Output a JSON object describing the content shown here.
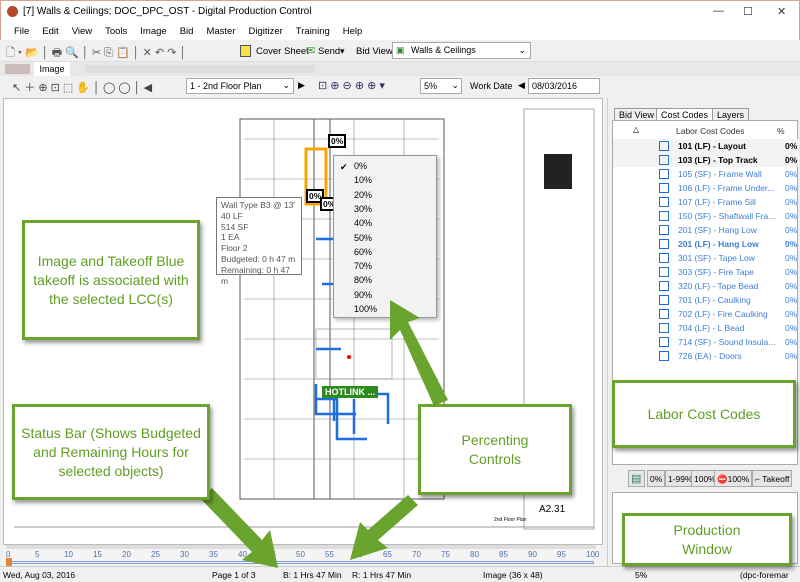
{
  "window": {
    "title": "[7] Walls & Ceilings; DOC_DPC_OST - Digital Production Control",
    "minimize": "—",
    "maximize": "☐",
    "close": "✕"
  },
  "menu": [
    "File",
    "Edit",
    "View",
    "Tools",
    "Image",
    "Bid",
    "Master",
    "Digitizer",
    "Training",
    "Help"
  ],
  "toolbar": {
    "cover_sheet": "Cover Sheet",
    "send": "Send",
    "bid_view_label": "Bid View",
    "bid_view_value": "Walls & Ceilings"
  },
  "tabs": {
    "active": "Image"
  },
  "toolbar2": {
    "page_select": "1 - 2nd Floor Plan",
    "zoom": "5%",
    "work_date_label": "Work Date",
    "work_date": "08/03/2016"
  },
  "popup": {
    "items": [
      "0%",
      "10%",
      "20%",
      "30%",
      "40%",
      "50%",
      "60%",
      "70%",
      "80%",
      "90%",
      "100%"
    ],
    "checked": "0%"
  },
  "tooltip": {
    "lines": [
      "Wall Type B3 @ 13'",
      "40 LF",
      "514 SF",
      "1 EA",
      "Floor 2",
      "Budgeted: 0 h 47 m",
      "Remaining: 0 h 47 m"
    ]
  },
  "badges": [
    "0%",
    "0%",
    "0%"
  ],
  "hotlink": "HOTLINK ...",
  "sheet": {
    "number": "A2.31",
    "title": "2nd Floor Plan"
  },
  "panel": {
    "tabs": [
      "Bid View",
      "Cost Codes",
      "Layers"
    ],
    "active_tab": "Cost Codes",
    "header": "Labor Cost Codes",
    "pct_header": "%",
    "rows": [
      {
        "label": "101 (LF) - Layout",
        "pct": "0%",
        "style": "bold-black"
      },
      {
        "label": "103 (LF) - Top Track",
        "pct": "0%",
        "style": "bold-black"
      },
      {
        "label": "105 (SF) - Frame Wall",
        "pct": "0%",
        "style": "blue"
      },
      {
        "label": "106 (LF) - Frame Under...",
        "pct": "0%",
        "style": "blue"
      },
      {
        "label": "107 (LF) - Frame Sill",
        "pct": "0%",
        "style": "blue"
      },
      {
        "label": "150 (SF) - Shaftwall Fra...",
        "pct": "0%",
        "style": "blue"
      },
      {
        "label": "201 (SF) - Hang Low",
        "pct": "0%",
        "style": "blue"
      },
      {
        "label": "201 (LF) - Hang Low",
        "pct": "0%",
        "style": "bold-blue"
      },
      {
        "label": "301 (SF) - Tape Low",
        "pct": "0%",
        "style": "blue"
      },
      {
        "label": "303 (SF) - Fire Tape",
        "pct": "0%",
        "style": "blue"
      },
      {
        "label": "320 (LF) - Tape Bead",
        "pct": "0%",
        "style": "blue"
      },
      {
        "label": "701 (LF) - Caulking",
        "pct": "0%",
        "style": "blue"
      },
      {
        "label": "702 (LF) - Fire Caulking",
        "pct": "0%",
        "style": "blue"
      },
      {
        "label": "704 (LF) - L Bead",
        "pct": "0%",
        "style": "blue"
      },
      {
        "label": "714 (SF) - Sound Insula...",
        "pct": "0%",
        "style": "blue"
      },
      {
        "label": "726 (EA) - Doors",
        "pct": "0%",
        "style": "blue"
      }
    ],
    "buttons": [
      "0%",
      "1-99%",
      "100%",
      "100%",
      "Takeoff"
    ]
  },
  "ruler": {
    "ticks": [
      "0",
      "5",
      "10",
      "15",
      "20",
      "25",
      "30",
      "35",
      "40",
      "45",
      "50",
      "55",
      "60",
      "65",
      "70",
      "75",
      "80",
      "85",
      "90",
      "95",
      "100"
    ],
    "value": 0
  },
  "status": {
    "date": "Wed, Aug 03, 2016",
    "page": "Page 1 of 3",
    "budgeted": "B: 1 Hrs 47 Min",
    "remaining": "R: 1 Hrs 47 Min",
    "image": "Image (36 x 48)",
    "zoom": "5%",
    "user": "(dpc-foremar"
  },
  "callouts": {
    "image": "Image and Takeoff Blue takeoff is associated with the selected LCC(s)",
    "status": "Status Bar (Shows Budgeted and Remaining Hours for selected objects)",
    "percenting": "Percenting Controls",
    "lcc": "Labor Cost Codes",
    "production": "Production Window"
  },
  "colors": {
    "accent_green": "#6aa32d",
    "takeoff_blue": "#1e6fe0",
    "title_border": "#d9a38f"
  }
}
